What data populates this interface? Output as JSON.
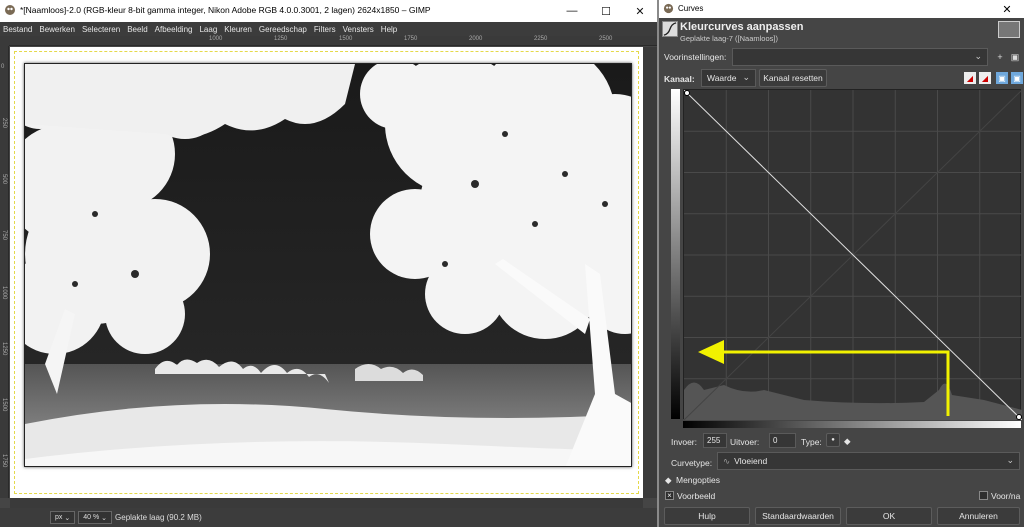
{
  "gimp": {
    "title": "*[Naamloos]-2.0 (RGB-kleur 8-bit gamma integer, Nikon Adobe RGB 4.0.0.3001, 2 lagen) 2624x1850 – GIMP",
    "menu": [
      "Bestand",
      "Bewerken",
      "Selecteren",
      "Beeld",
      "Afbeelding",
      "Laag",
      "Kleuren",
      "Gereedschap",
      "Filters",
      "Vensters",
      "Help"
    ],
    "ruler_h_ticks": [
      "1000",
      "1250",
      "1500",
      "1750",
      "2000",
      "2250",
      "2500"
    ],
    "ruler_v_ticks": [
      "0",
      "250",
      "500",
      "750",
      "1000",
      "1250",
      "1500",
      "1750"
    ],
    "status": {
      "unit": "px",
      "zoom": "40 %",
      "layer_info": "Geplakte laag (90.2 MB)"
    }
  },
  "curves": {
    "title": "Curves",
    "heading": "Kleurcurves aanpassen",
    "subheading": "Geplakte laag-7 ([Naamloos])",
    "presets_label": "Voorinstellingen:",
    "channel_label": "Kanaal:",
    "channel_value": "Waarde",
    "reset_channel": "Kanaal resetten",
    "input_label": "Invoer:",
    "input_value": "255",
    "output_label": "Uitvoer:",
    "output_value": "0",
    "type_label": "Type:",
    "curve_type_label": "Curvetype:",
    "curve_type_value": "Vloeiend",
    "blend_options": "Mengopties",
    "preview_label": "Voorbeeld",
    "split_label": "Voor/na",
    "buttons": {
      "help": "Hulp",
      "defaults": "Standaardwaarden",
      "ok": "OK",
      "cancel": "Annuleren"
    },
    "curve_points": [
      [
        0,
        255
      ],
      [
        255,
        0
      ]
    ],
    "annotation_color": "#f2f200"
  }
}
